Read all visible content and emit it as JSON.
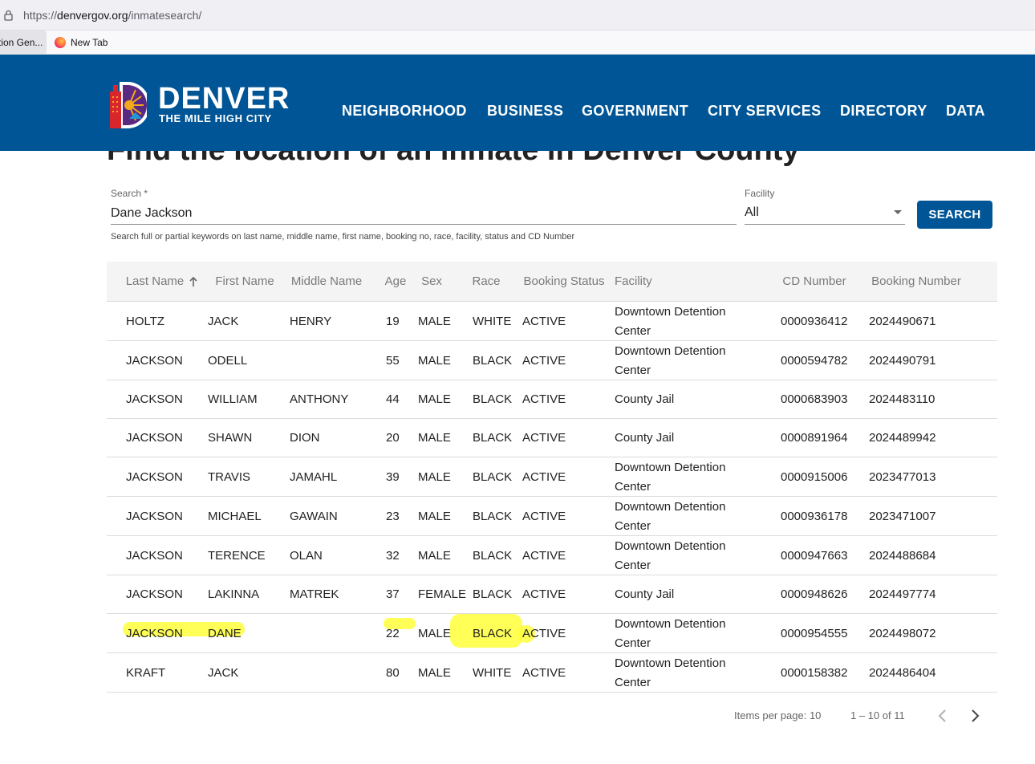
{
  "browser": {
    "url_scheme": "https://",
    "url_host": "denvergov.org",
    "url_path": "/inmatesearch/",
    "bookmarks": [
      "tion Gen...",
      "New Tab"
    ]
  },
  "header": {
    "logo_word": "DENVER",
    "logo_tagline": "THE MILE HIGH CITY",
    "nav": [
      "NEIGHBORHOOD",
      "BUSINESS",
      "GOVERNMENT",
      "CITY SERVICES",
      "DIRECTORY",
      "DATA"
    ],
    "color_bg": "#005596"
  },
  "page": {
    "title": "Find the location of an inmate in Denver County"
  },
  "search": {
    "label": "Search *",
    "value": "Dane Jackson",
    "facility_label": "Facility",
    "facility_value": "All",
    "button": "SEARCH",
    "hint": "Search full or partial keywords on last name, middle name, first name, booking no, race, facility, status and CD Number"
  },
  "table": {
    "headers": [
      "Last Name",
      "First Name",
      "Middle Name",
      "Age",
      "Sex",
      "Race",
      "Booking Status",
      "Facility",
      "CD Number",
      "Booking Number"
    ],
    "rows": [
      [
        "HOLTZ",
        "JACK",
        "HENRY",
        "19",
        "MALE",
        "WHITE",
        "ACTIVE",
        "Downtown Detention Center",
        "0000936412",
        "2024490671"
      ],
      [
        "JACKSON",
        "ODELL",
        "",
        "55",
        "MALE",
        "BLACK",
        "ACTIVE",
        "Downtown Detention Center",
        "0000594782",
        "2024490791"
      ],
      [
        "JACKSON",
        "WILLIAM",
        "ANTHONY",
        "44",
        "MALE",
        "BLACK",
        "ACTIVE",
        "County Jail",
        "0000683903",
        "2024483110"
      ],
      [
        "JACKSON",
        "SHAWN",
        "DION",
        "20",
        "MALE",
        "BLACK",
        "ACTIVE",
        "County Jail",
        "0000891964",
        "2024489942"
      ],
      [
        "JACKSON",
        "TRAVIS",
        "JAMAHL",
        "39",
        "MALE",
        "BLACK",
        "ACTIVE",
        "Downtown Detention Center",
        "0000915006",
        "2023477013"
      ],
      [
        "JACKSON",
        "MICHAEL",
        "GAWAIN",
        "23",
        "MALE",
        "BLACK",
        "ACTIVE",
        "Downtown Detention Center",
        "0000936178",
        "2023471007"
      ],
      [
        "JACKSON",
        "TERENCE",
        "OLAN",
        "32",
        "MALE",
        "BLACK",
        "ACTIVE",
        "Downtown Detention Center",
        "0000947663",
        "2024488684"
      ],
      [
        "JACKSON",
        "LAKINNA",
        "MATREK",
        "37",
        "FEMALE",
        "BLACK",
        "ACTIVE",
        "County Jail",
        "0000948626",
        "2024497774"
      ],
      [
        "JACKSON",
        "DANE",
        "",
        "22",
        "MALE",
        "BLACK",
        "ACTIVE",
        "Downtown Detention Center",
        "0000954555",
        "2024498072"
      ],
      [
        "KRAFT",
        "JACK",
        "",
        "80",
        "MALE",
        "WHITE",
        "ACTIVE",
        "Downtown Detention Center",
        "0000158382",
        "2024486404"
      ]
    ],
    "highlighted_row_index": 8,
    "highlight_color": "#ffff3a"
  },
  "paginator": {
    "items_per_page": "Items per page: 10",
    "range": "1 – 10 of 11"
  }
}
